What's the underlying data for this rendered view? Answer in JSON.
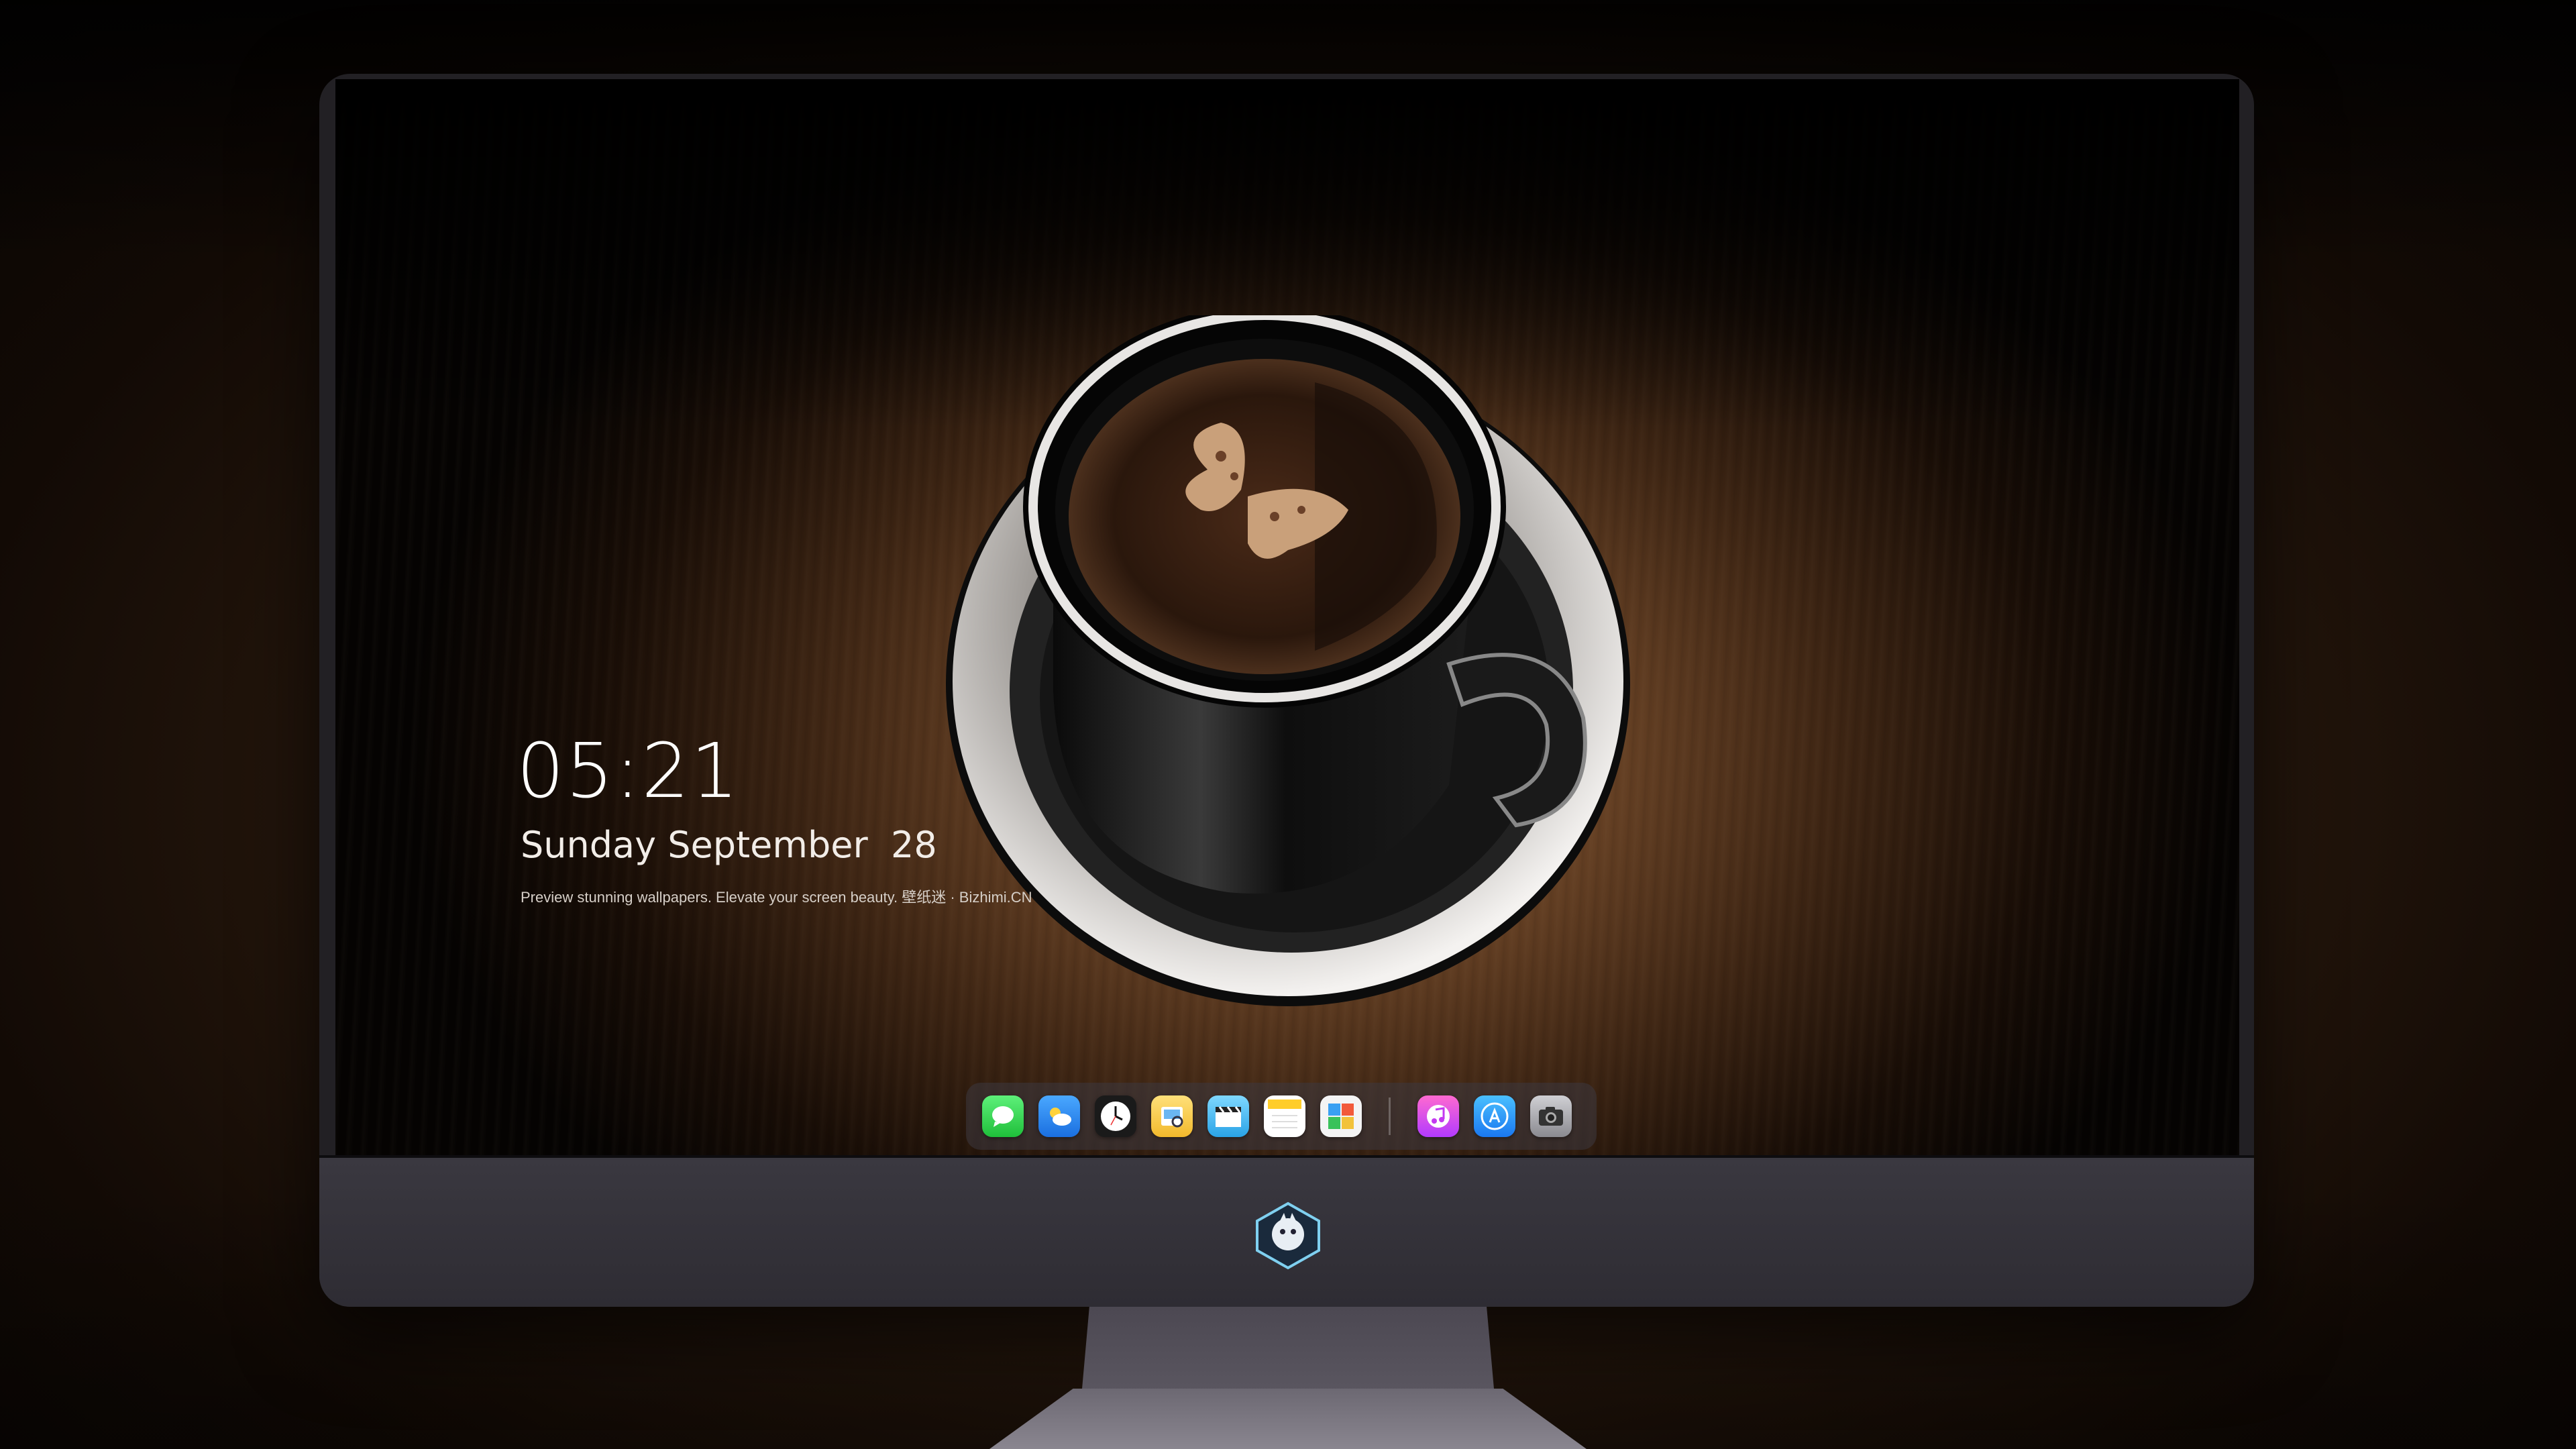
{
  "lock_screen": {
    "time": "05:21",
    "date": "Sunday September  28",
    "tagline": "Preview stunning wallpapers. Elevate your screen beauty. 壁纸迷 · Bizhimi.CN"
  },
  "dock": {
    "apps": [
      "messages-icon",
      "weather-icon",
      "clock-icon",
      "preview-icon",
      "clapperboard-icon",
      "notes-icon",
      "photos-icon"
    ],
    "apps_right": [
      "music-icon",
      "app-store-icon",
      "camera-icon"
    ]
  },
  "colors": {
    "wood_center": "#8a5a34",
    "monitor_bezel": "#222024",
    "chin": "#3a3840",
    "text": "#ffffff"
  }
}
